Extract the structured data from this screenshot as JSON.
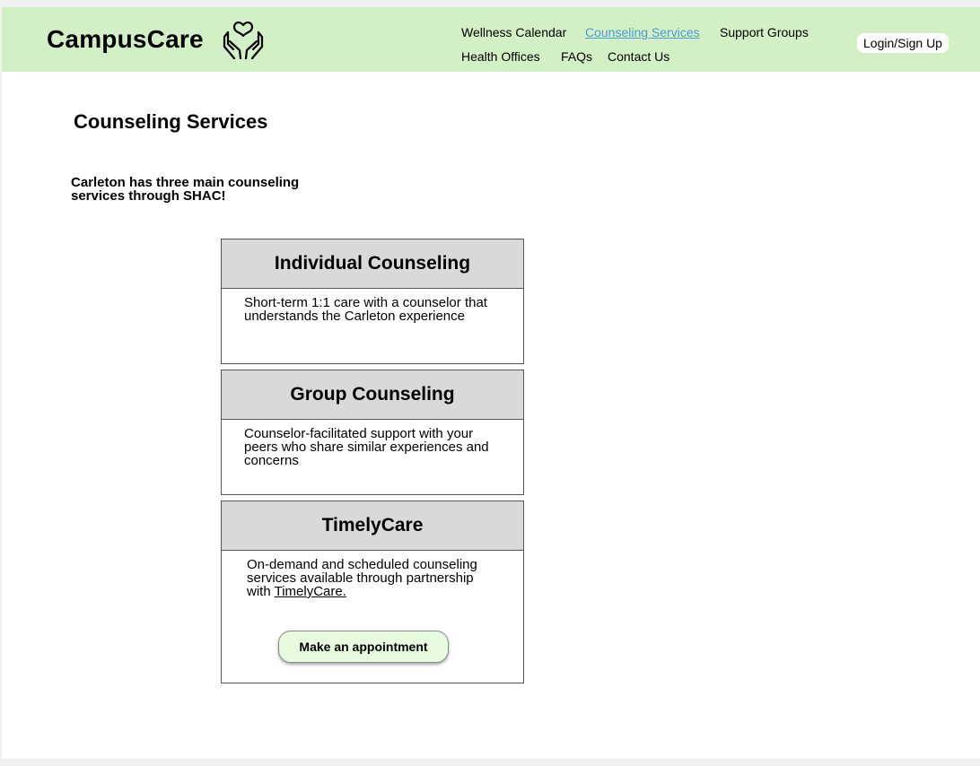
{
  "header": {
    "brand": "CampusCare",
    "logo_icon": "hands-holding-heart-icon",
    "nav": [
      {
        "label": "Wellness Calendar",
        "active": false
      },
      {
        "label": "Counseling Services",
        "active": true
      },
      {
        "label": "Support Groups",
        "active": false
      },
      {
        "label": "Health Offices",
        "active": false
      },
      {
        "label": "FAQs",
        "active": false
      },
      {
        "label": "Contact Us",
        "active": false
      }
    ],
    "login_label": "Login/Sign Up",
    "background": "#d3efc6",
    "active_link_color": "#4a9bd6"
  },
  "main": {
    "title": "Counseling Services",
    "intro": "Carleton has three main counseling services through SHAC!",
    "cards": [
      {
        "title": "Individual Counseling",
        "description": "Short-term 1:1 care with a counselor that understands the Carleton experience"
      },
      {
        "title": "Group Counseling",
        "description": "Counselor-facilitated support with your peers who share similar experiences and concerns"
      },
      {
        "title": "TimelyCare",
        "description": "On-demand and scheduled counseling services available through partnership with",
        "link_text": "TimelyCare.",
        "button_label": "Make an appointment"
      }
    ]
  }
}
